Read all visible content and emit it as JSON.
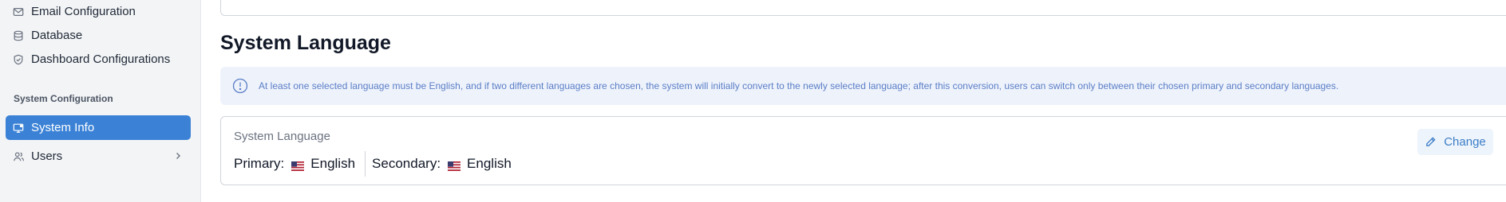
{
  "sidebar": {
    "items": [
      {
        "label": "Email Configuration",
        "icon": "mail-icon"
      },
      {
        "label": "Database",
        "icon": "database-icon"
      },
      {
        "label": "Dashboard Configurations",
        "icon": "shield-check-icon"
      }
    ],
    "section_title": "System Configuration",
    "section_items": [
      {
        "label": "System Info",
        "icon": "monitor-icon",
        "active": true
      },
      {
        "label": "Users",
        "icon": "users-icon",
        "has_submenu": true
      }
    ]
  },
  "main": {
    "title": "System Language",
    "alert": {
      "icon": "info-icon",
      "text": "At least one selected language must be English, and if two different languages are chosen, the system will initially convert to the newly selected language; after this conversion, users can switch only between their chosen primary and secondary languages."
    },
    "language_card": {
      "label": "System Language",
      "primary_label": "Primary:",
      "primary_value": "English",
      "secondary_label": "Secondary:",
      "secondary_value": "English",
      "flag_icon": "us-flag-icon",
      "change_button": "Change",
      "change_icon": "pencil-icon"
    }
  },
  "colors": {
    "accent": "#3b82d6",
    "alert_bg": "#eef2fb",
    "alert_text": "#5b7fc7"
  }
}
